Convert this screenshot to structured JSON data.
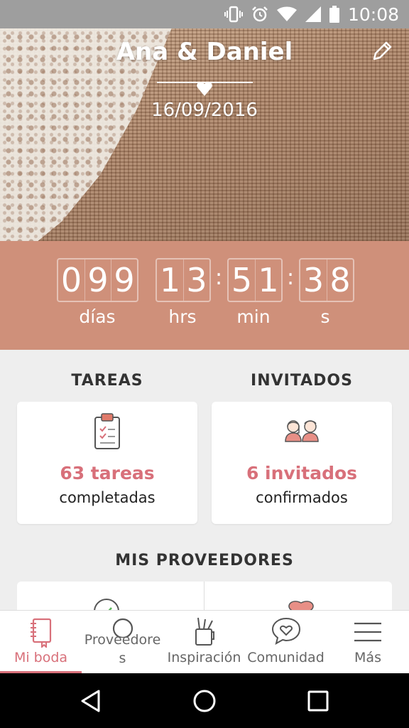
{
  "status_bar": {
    "time": "10:08"
  },
  "header": {
    "couple": "Ana & Daniel",
    "date": "16/09/2016"
  },
  "countdown": {
    "days": [
      "0",
      "9",
      "9"
    ],
    "hours": [
      "1",
      "3"
    ],
    "minutes": [
      "5",
      "1"
    ],
    "seconds": [
      "3",
      "8"
    ],
    "separator": ":",
    "labels": {
      "days": "días",
      "hours": "hrs",
      "minutes": "min",
      "seconds": "s"
    }
  },
  "tasks": {
    "title": "TAREAS",
    "count_text": "63 tareas",
    "status": "completadas"
  },
  "guests": {
    "title": "INVITADOS",
    "count_text": "6 invitados",
    "status": "confirmados"
  },
  "providers": {
    "title": "MIS PROVEEDORES"
  },
  "bottom_nav": {
    "items": [
      {
        "label": "Mi boda",
        "icon": "notebook-icon",
        "active": true
      },
      {
        "label": "Proveedore\ns",
        "icon": "search-icon",
        "active": false
      },
      {
        "label": "Inspiración",
        "icon": "pencil-cup-icon",
        "active": false
      },
      {
        "label": "Comunidad",
        "icon": "chat-heart-icon",
        "active": false
      },
      {
        "label": "Más",
        "icon": "menu-icon",
        "active": false
      }
    ]
  },
  "colors": {
    "accent": "#d8707a",
    "countdown_bg": "#cf907a",
    "status_bar": "#9e9e9e"
  }
}
